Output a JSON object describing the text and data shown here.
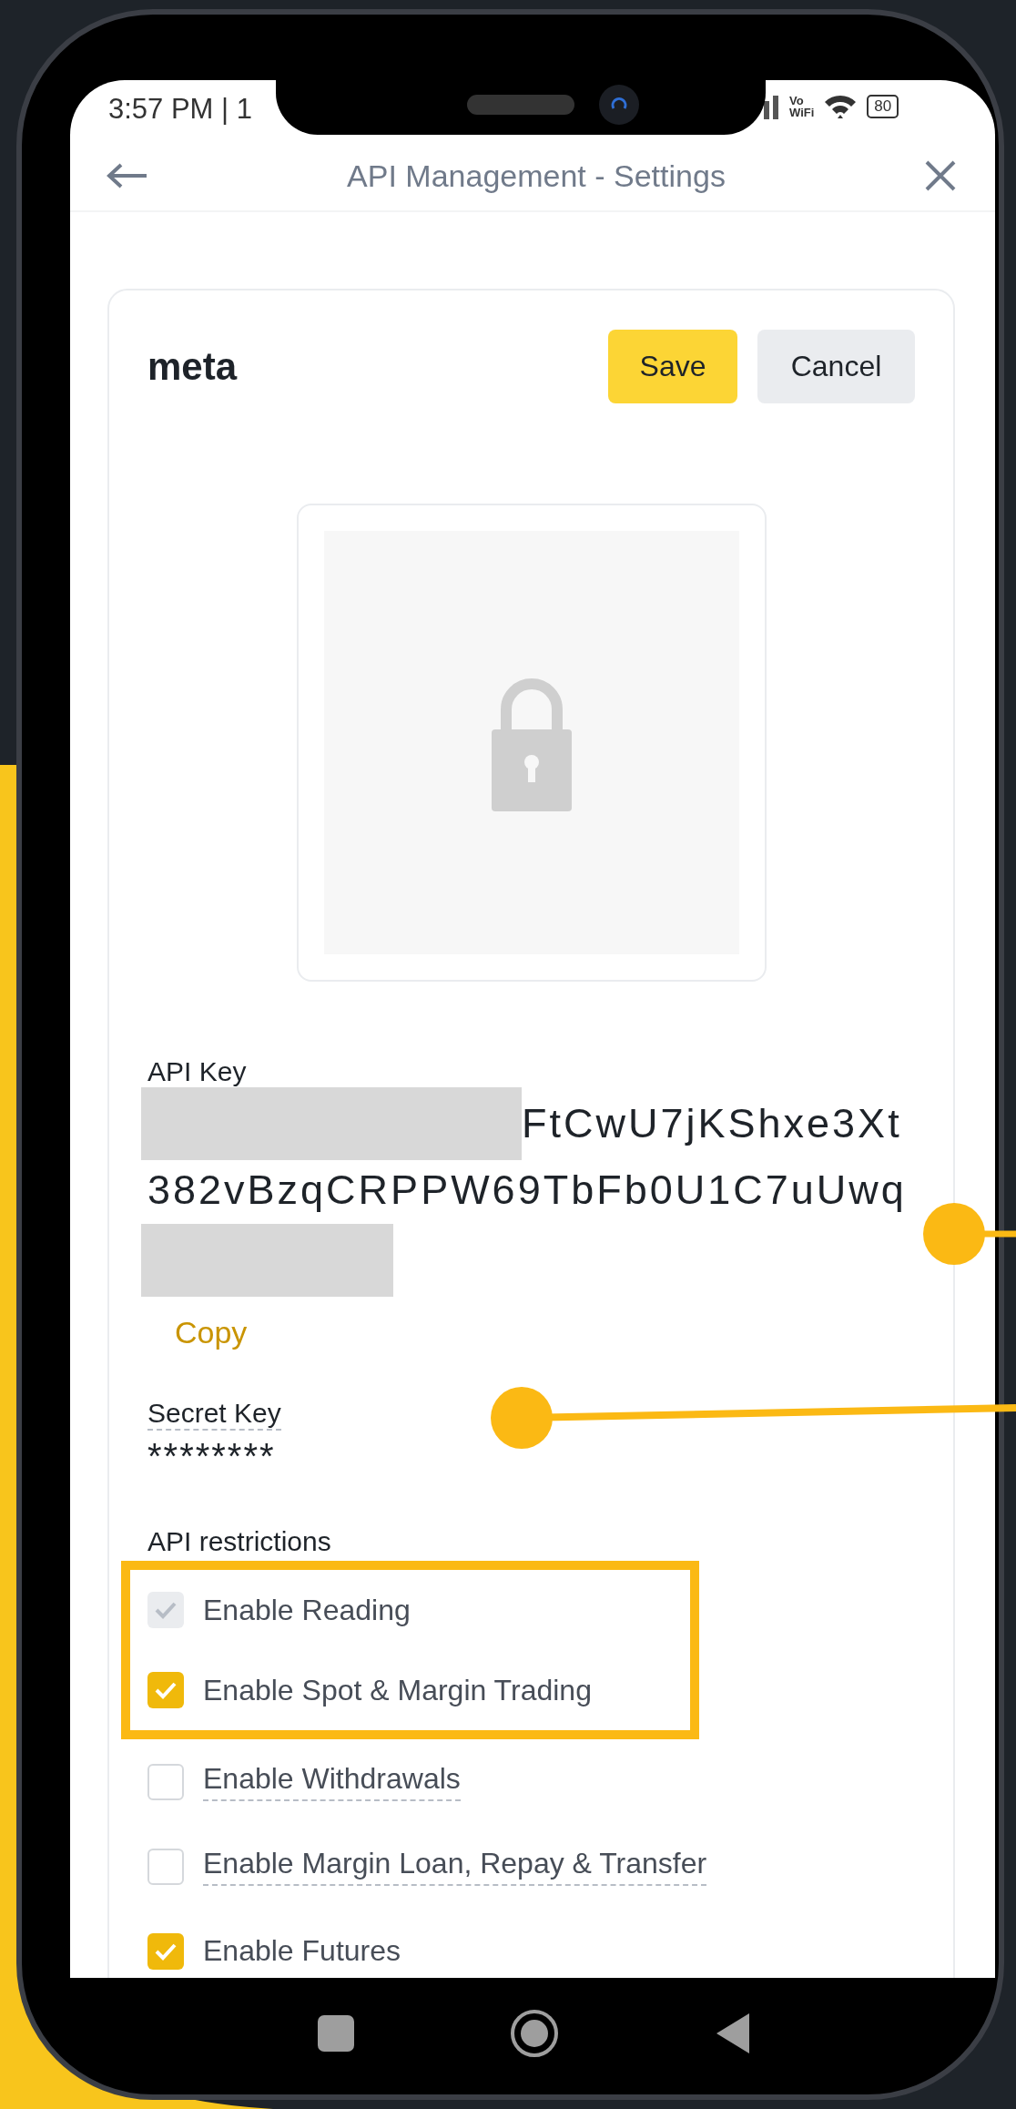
{
  "status_bar": {
    "time": "3:57 PM | 1",
    "call_labels": [
      "Vo",
      "WiFi"
    ],
    "battery": "80"
  },
  "header": {
    "title": "API Management - Settings"
  },
  "api_card": {
    "name": "meta",
    "buttons": [
      {
        "label": "Save",
        "kind": "primary"
      },
      {
        "label": "Cancel",
        "kind": "secondary"
      }
    ],
    "api_key": {
      "label": "API Key",
      "lines": [
        [
          {
            "kind": "redaction"
          },
          {
            "kind": "text",
            "text": "FtCwU7jKShxe3Xt"
          }
        ],
        [
          {
            "kind": "text",
            "text": "382vBzqCRPPW69TbFb0U1C7uUwq"
          }
        ],
        [
          {
            "kind": "redaction"
          }
        ]
      ]
    },
    "copy": "Copy",
    "secret_key": {
      "label": "Secret Key",
      "value": "********"
    },
    "restrictions": {
      "title": "API restrictions",
      "items": [
        {
          "label": "Enable Reading",
          "checked": true,
          "disabled": true,
          "tooltip": false,
          "highlighted": true
        },
        {
          "label": "Enable Spot & Margin Trading",
          "checked": true,
          "disabled": false,
          "tooltip": false,
          "highlighted": true
        },
        {
          "label": "Enable Withdrawals",
          "checked": false,
          "disabled": false,
          "tooltip": true,
          "highlighted": false
        },
        {
          "label": "Enable Margin Loan, Repay & Transfer",
          "checked": false,
          "disabled": false,
          "tooltip": true,
          "highlighted": false
        },
        {
          "label": "Enable Futures",
          "checked": true,
          "disabled": false,
          "tooltip": false,
          "highlighted": false
        }
      ]
    }
  }
}
